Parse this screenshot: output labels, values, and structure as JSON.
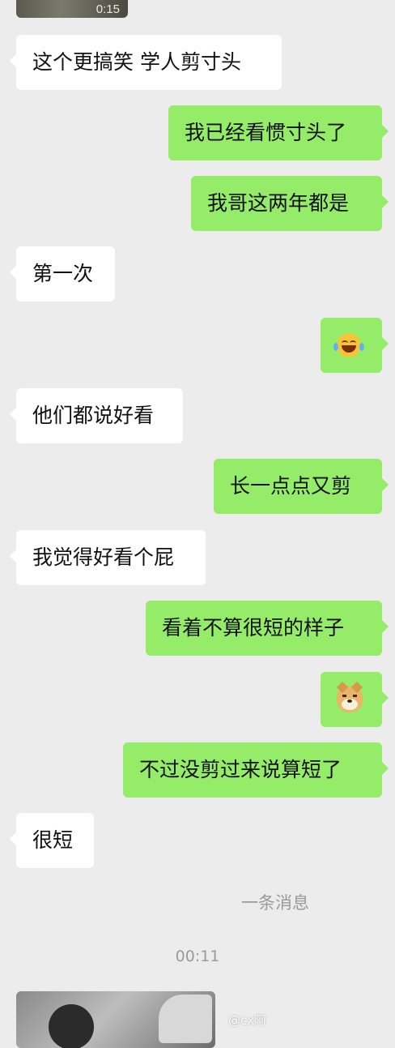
{
  "top_video": {
    "duration": "0:15"
  },
  "messages": [
    {
      "dir": "in",
      "text": "这个更搞笑 学人剪寸头"
    },
    {
      "dir": "out",
      "text": "我已经看惯寸头了"
    },
    {
      "dir": "out",
      "text": "我哥这两年都是"
    },
    {
      "dir": "in",
      "text": "第一次"
    },
    {
      "dir": "out",
      "emoji": "laughing-tears-emoji"
    },
    {
      "dir": "in",
      "text": "他们都说好看"
    },
    {
      "dir": "out",
      "text": "长一点点又剪"
    },
    {
      "dir": "in",
      "text": "我觉得好看个屁"
    },
    {
      "dir": "out",
      "text": "看着不算很短的样子"
    },
    {
      "dir": "out",
      "emoji": "doge-emoji"
    },
    {
      "dir": "out",
      "text": "不过没剪过来说算短了"
    },
    {
      "dir": "in",
      "text": "很短"
    }
  ],
  "system": {
    "recalled": "一条消息",
    "timestamp": "00:11"
  },
  "watermark": "@cx阿"
}
